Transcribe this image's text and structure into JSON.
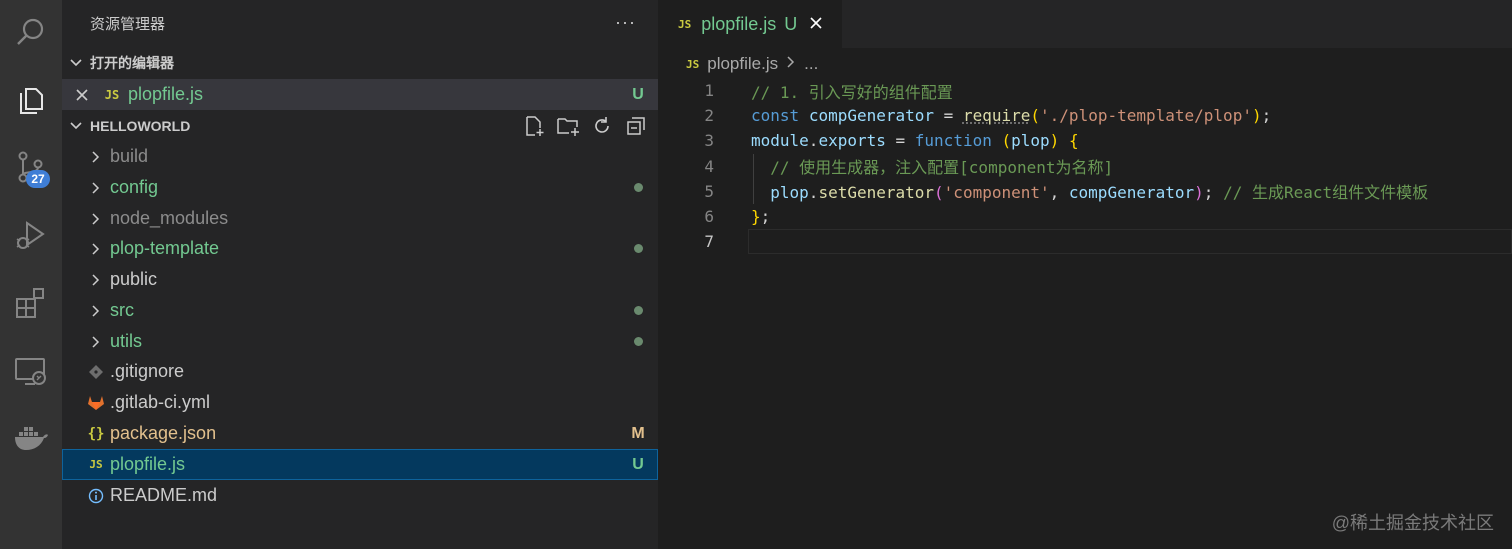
{
  "activity_bar": {
    "items": [
      {
        "icon": "search-icon"
      },
      {
        "icon": "files-icon"
      },
      {
        "icon": "source-control-icon",
        "badge": "27"
      },
      {
        "icon": "run-debug-icon"
      },
      {
        "icon": "extensions-icon"
      },
      {
        "icon": "remote-explorer-icon"
      },
      {
        "icon": "docker-icon"
      }
    ],
    "badge_color": "#3f7ed6"
  },
  "sidebar": {
    "title": "资源管理器",
    "more": "···",
    "open_editors": {
      "header": "打开的编辑器",
      "items": [
        {
          "name": "plopfile.js",
          "icon": "JS",
          "status": "U"
        }
      ]
    },
    "workspace": {
      "header": "HELLOWORLD",
      "items": [
        {
          "name": "build",
          "type": "folder",
          "status": ""
        },
        {
          "name": "config",
          "type": "folder",
          "status": "dot"
        },
        {
          "name": "node_modules",
          "type": "folder",
          "status": ""
        },
        {
          "name": "plop-template",
          "type": "folder",
          "status": "dot"
        },
        {
          "name": "public",
          "type": "folder",
          "status": ""
        },
        {
          "name": "src",
          "type": "folder",
          "status": "dot"
        },
        {
          "name": "utils",
          "type": "folder",
          "status": "dot"
        },
        {
          "name": ".gitignore",
          "type": "file",
          "icon": "git-icon",
          "status": ""
        },
        {
          "name": ".gitlab-ci.yml",
          "type": "file",
          "icon": "gitlab-icon",
          "status": ""
        },
        {
          "name": "package.json",
          "type": "file",
          "icon": "{}",
          "status": "M"
        },
        {
          "name": "plopfile.js",
          "type": "file",
          "icon": "JS",
          "status": "U"
        },
        {
          "name": "README.md",
          "type": "file",
          "icon": "info-icon",
          "status": ""
        }
      ]
    }
  },
  "editor": {
    "tab": {
      "icon": "JS",
      "name": "plopfile.js",
      "flag": "U"
    },
    "breadcrumb": {
      "file": "plopfile.js",
      "more": "..."
    },
    "line_numbers": [
      "1",
      "2",
      "3",
      "4",
      "5",
      "6",
      "7"
    ],
    "code": {
      "l1": "// 1. 引入写好的组件配置",
      "l2_const": "const",
      "l2_var": "compGenerator",
      "l2_eq": " = ",
      "l2_fn": "require",
      "l2_str": "'./plop-template/plop'",
      "l2_end": ";",
      "l3_mod": "module",
      "l3_dot": ".",
      "l3_exp": "exports",
      "l3_eq": " = ",
      "l3_kw": "function",
      "l3_param": "plop",
      "l4": "// 使用生成器，注入配置[component为名称]",
      "l5_obj": "plop",
      "l5_dot": ".",
      "l5_fn": "setGenerator",
      "l5_str": "'component'",
      "l5_comma": ", ",
      "l5_var": "compGenerator",
      "l5_end": ";",
      "l5_com": "// 生成React组件文件模板",
      "l6_end": ";"
    }
  },
  "watermark": "@稀土掘金技术社区"
}
